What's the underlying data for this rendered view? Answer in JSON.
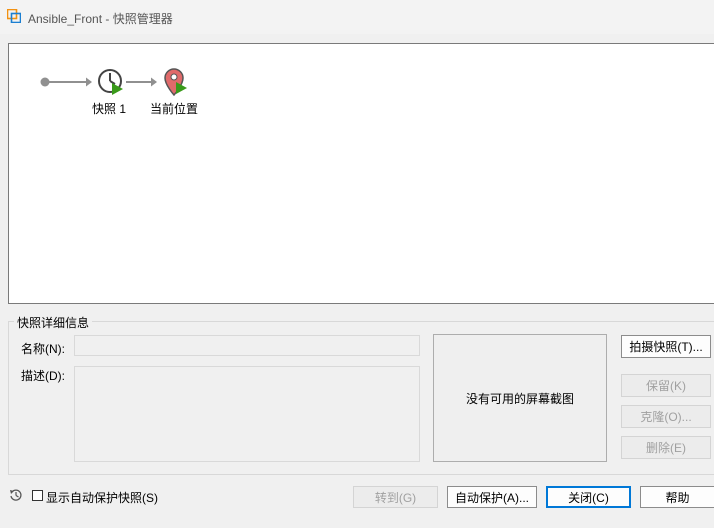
{
  "window": {
    "title": "Ansible_Front - 快照管理器"
  },
  "tree": {
    "nodes": [
      {
        "label": "快照 1",
        "icon": "clock-snapshot-icon"
      },
      {
        "label": "当前位置",
        "icon": "location-pin-icon"
      }
    ]
  },
  "details": {
    "group_title": "快照详细信息",
    "name_label": "名称(N):",
    "name_value": "",
    "desc_label": "描述(D):",
    "desc_value": "",
    "screenshot_placeholder": "没有可用的屏幕截图"
  },
  "side_buttons": {
    "take": "拍摄快照(T)...",
    "keep": "保留(K)",
    "clone": "克隆(O)...",
    "delete": "删除(E)"
  },
  "footer": {
    "show_autoprotect_label": "显示自动保护快照(S)",
    "show_autoprotect_checked": false,
    "goto": "转到(G)",
    "autoprotect": "自动保护(A)...",
    "close": "关闭(C)",
    "help": "帮助"
  },
  "colors": {
    "accent": "#0078d7",
    "play_green": "#3a9a1a",
    "pin_red": "#e06a6a"
  }
}
